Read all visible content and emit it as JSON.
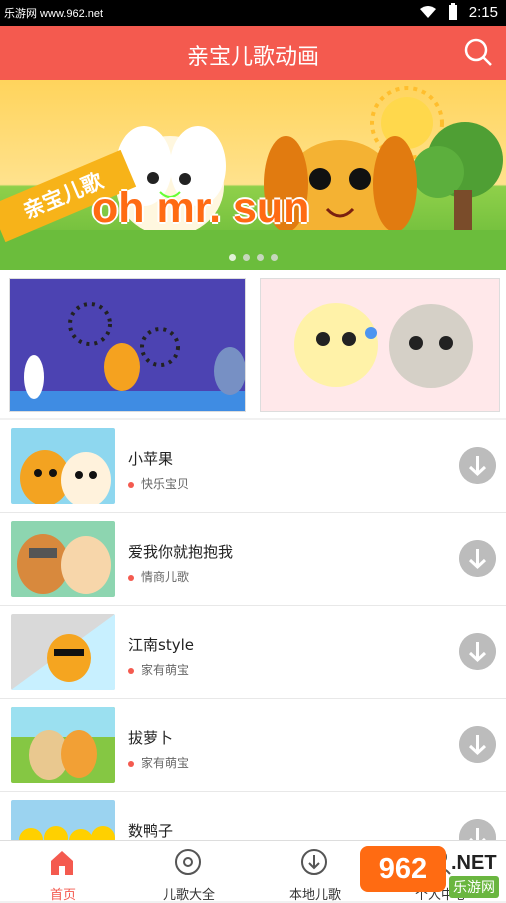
{
  "status": {
    "watermark": "乐游网 www.962.net",
    "time": "2:15"
  },
  "app": {
    "title": "亲宝儿歌动画"
  },
  "banner": {
    "tag": "亲宝儿歌",
    "song": "oh mr. sun"
  },
  "songs": [
    {
      "title": "小苹果",
      "category": "快乐宝贝"
    },
    {
      "title": "爱我你就抱抱我",
      "category": "情商儿歌"
    },
    {
      "title": "江南style",
      "category": "家有萌宝"
    },
    {
      "title": "拔萝卜",
      "category": "家有萌宝"
    },
    {
      "title": "数鸭子",
      "category": ""
    }
  ],
  "tabs": {
    "home": "首页",
    "all": "儿歌大全",
    "local": "本地儿歌",
    "mine": "个人中心"
  },
  "overlay": {
    "number": "962",
    "net": ".NET",
    "brand": "乐游网"
  }
}
